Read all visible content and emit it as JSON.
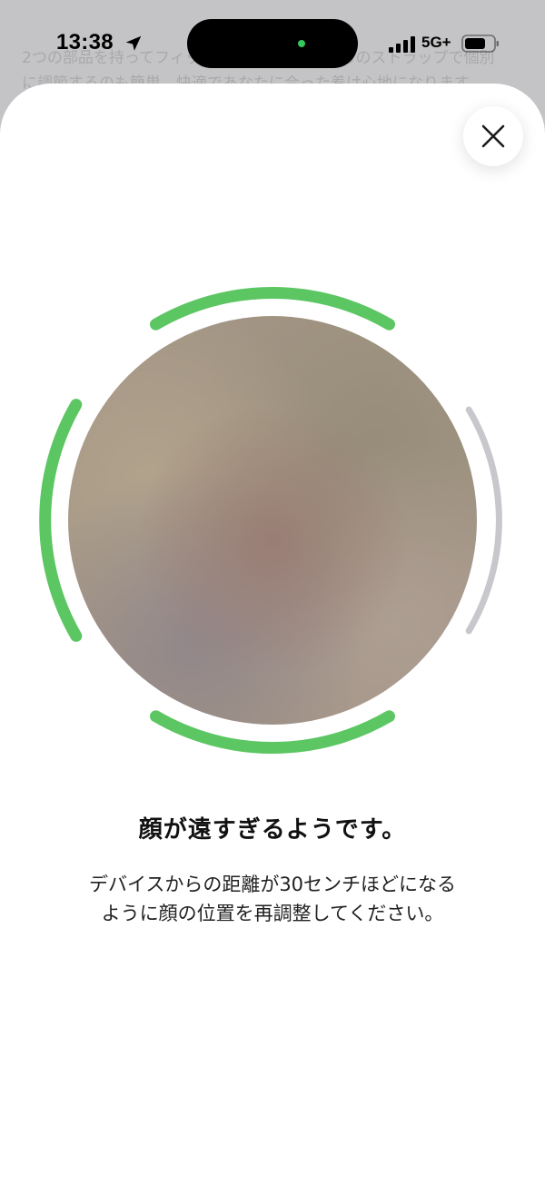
{
  "background": {
    "text": "2つの部品を持ってフィットさせ、バンドの裏ろのストラップで個別\nに調節するのも簡単。快適であなたに合った着け心地になります。"
  },
  "status_bar": {
    "time": "13:38",
    "network": "5G+",
    "location_icon": "location-arrow-icon",
    "signal_icon": "cellular-signal-icon",
    "battery_icon": "battery-icon"
  },
  "sheet": {
    "close_icon": "close-icon",
    "title": "顔が遠すぎるようです。",
    "body": "デバイスからの距離が30センチほどになる\nように顔の位置を再調整してください。"
  },
  "colors": {
    "progress_active": "#5cc663",
    "progress_inactive": "#c7c7cc",
    "island_indicator": "#35c759"
  }
}
